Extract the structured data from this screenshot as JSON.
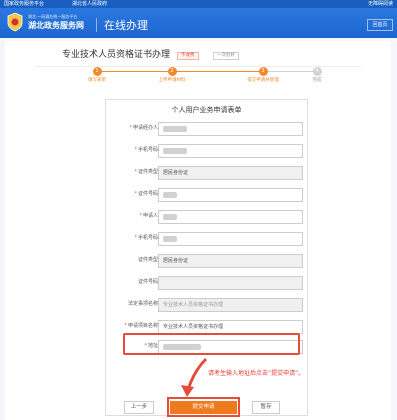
{
  "topbar": {
    "left1": "国家政务服务平台",
    "left2": "湖北省人民政府",
    "right": "无障碍阅读"
  },
  "header": {
    "brand_small": "湖北·一网通办统一服务平台",
    "brand_name": "湖北政务服务网",
    "section_title": "在线办理",
    "home_button": "回首页"
  },
  "page": {
    "title": "专业技术人员资格证书办理",
    "badge_fee": "不收费",
    "badge_visit": "一次办好"
  },
  "steps": [
    {
      "num": "1",
      "label": "填写表单",
      "state": "done"
    },
    {
      "num": "2",
      "label": "上传申请材料",
      "state": "done"
    },
    {
      "num": "3",
      "label": "提交申请并受理",
      "state": "active"
    },
    {
      "num": "4",
      "label": "完成",
      "state": "pending"
    }
  ],
  "form": {
    "title": "个人用户业务申请表单",
    "fields": [
      {
        "label": "申请经办人",
        "required": true,
        "value": "",
        "gray": false
      },
      {
        "label": "手机号码",
        "required": true,
        "value": "",
        "gray": false
      },
      {
        "label": "证件类型",
        "required": true,
        "value": "居民身份证",
        "gray": true
      },
      {
        "label": "证件号码",
        "required": true,
        "value": "",
        "gray": false
      },
      {
        "label": "申请人",
        "required": true,
        "value": "",
        "gray": false
      },
      {
        "label": "手机号码",
        "required": true,
        "value": "",
        "gray": false
      },
      {
        "label": "证件类型",
        "required": false,
        "value": "居民身份证",
        "gray": true
      },
      {
        "label": "证件号码",
        "required": false,
        "value": "",
        "gray": true
      },
      {
        "label": "法定事项名称",
        "required": false,
        "value": "专业技术人员资格证书办理",
        "gray": true
      },
      {
        "label": "申请项目名称",
        "required": true,
        "value": "专业技术人员资格证书办理",
        "gray": false
      },
      {
        "label": "地址",
        "required": true,
        "value": "",
        "gray": false
      }
    ]
  },
  "annotation": {
    "text": "请考生输入地址后点击“提交申请”。"
  },
  "buttons": {
    "prev": "上一步",
    "submit": "提交申请",
    "save": "暂存"
  },
  "colors": {
    "brand_blue": "#1e66cf",
    "accent_orange": "#f07b1e",
    "highlight_red": "#e84b3a"
  }
}
